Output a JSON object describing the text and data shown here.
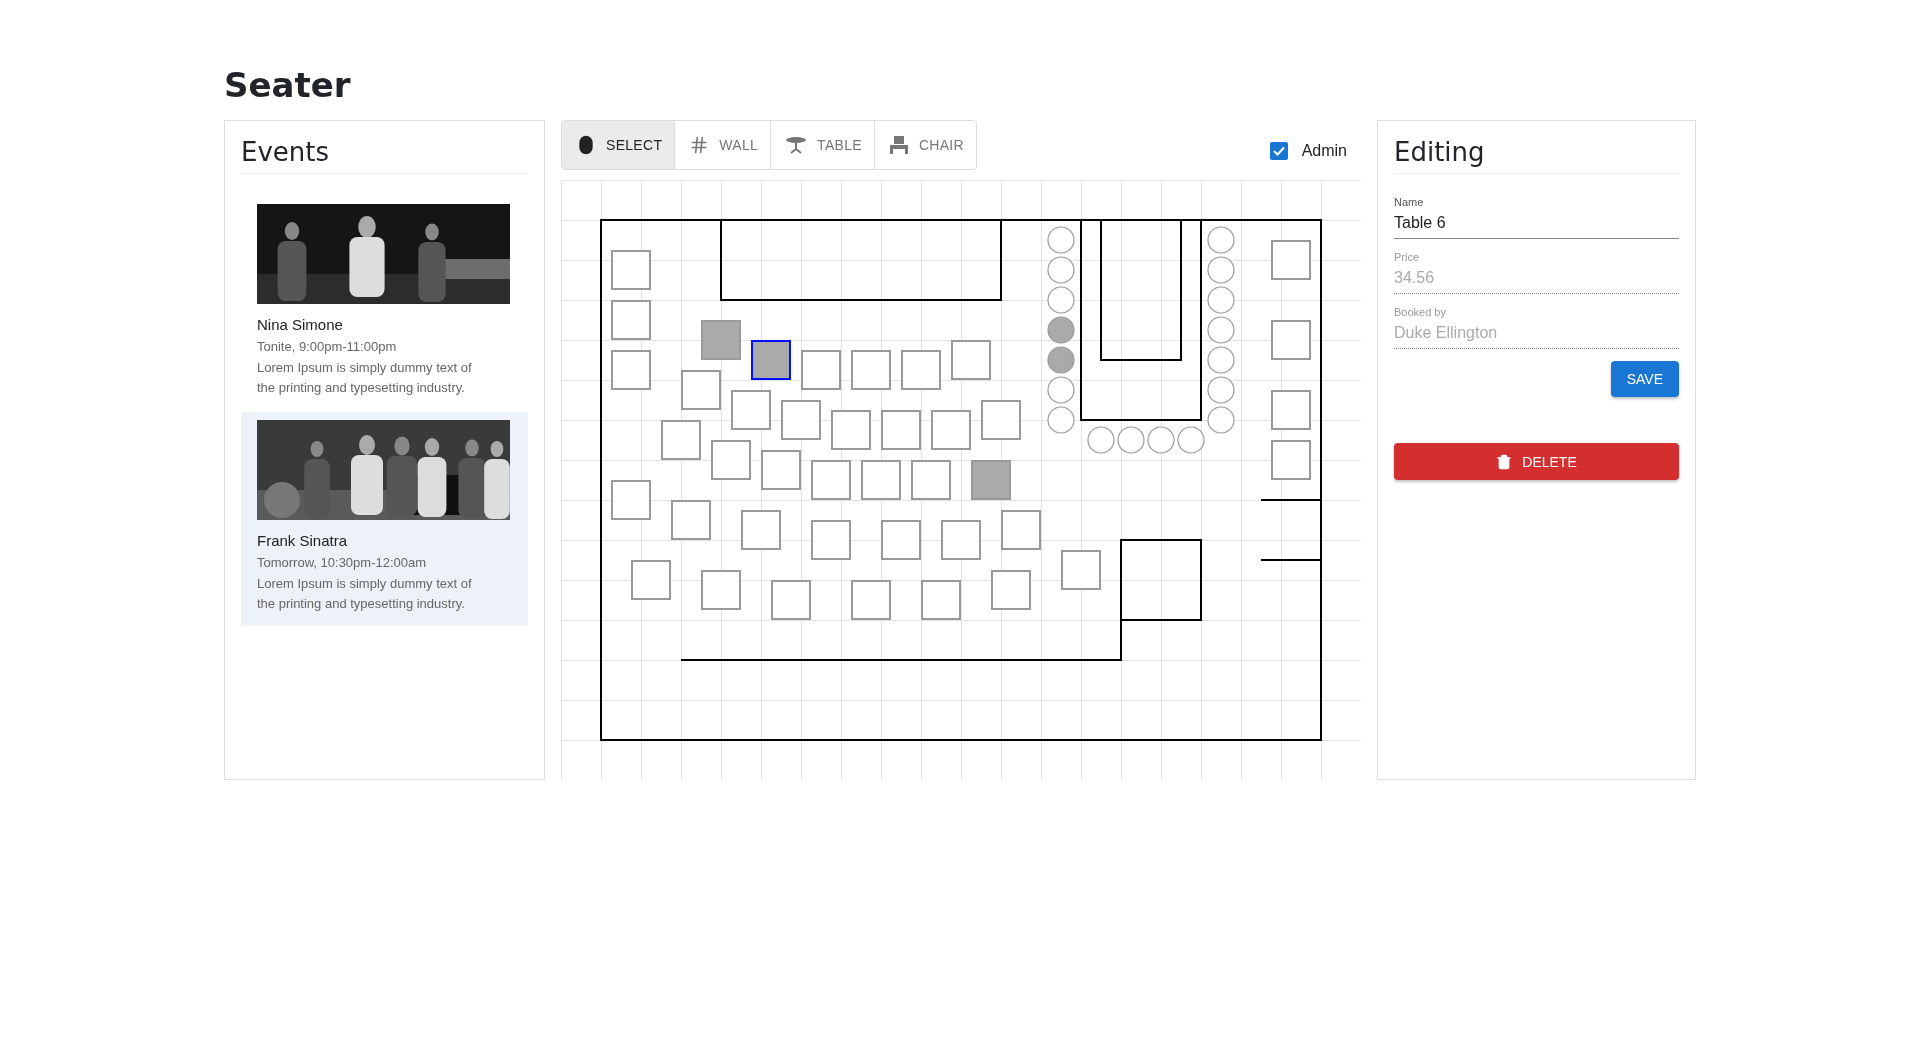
{
  "app_title": "Seater",
  "events": {
    "title": "Events",
    "items": [
      {
        "name": "Nina Simone",
        "time": "Tonite, 9:00pm-11:00pm",
        "description": "Lorem Ipsum is simply dummy text of the printing and typesetting industry.",
        "selected": false
      },
      {
        "name": "Frank Sinatra",
        "time": "Tomorrow, 10:30pm-12:00am",
        "description": "Lorem Ipsum is simply dummy text of the printing and typesetting industry.",
        "selected": true
      }
    ]
  },
  "toolbar": {
    "tools": [
      {
        "label": "SELECT",
        "kind": "select",
        "selected": true
      },
      {
        "label": "WALL",
        "kind": "wall",
        "selected": false
      },
      {
        "label": "TABLE",
        "kind": "table",
        "selected": false
      },
      {
        "label": "CHAIR",
        "kind": "chair",
        "selected": false
      }
    ],
    "admin": {
      "label": "Admin",
      "checked": true
    }
  },
  "floor": {
    "tables": [
      {
        "booked": false,
        "selected": false
      },
      {
        "booked": false,
        "selected": false
      },
      {
        "booked": false,
        "selected": false
      },
      {
        "booked": true,
        "selected": false
      },
      {
        "booked": true,
        "selected": true
      },
      {
        "booked": false,
        "selected": false
      },
      {
        "booked": false,
        "selected": false
      },
      {
        "booked": false,
        "selected": false
      },
      {
        "booked": false,
        "selected": false
      },
      {
        "booked": false,
        "selected": false
      },
      {
        "booked": false,
        "selected": false
      },
      {
        "booked": false,
        "selected": false
      },
      {
        "booked": false,
        "selected": false
      },
      {
        "booked": false,
        "selected": false
      },
      {
        "booked": false,
        "selected": false
      },
      {
        "booked": false,
        "selected": false
      },
      {
        "booked": false,
        "selected": false
      },
      {
        "booked": false,
        "selected": false
      },
      {
        "booked": false,
        "selected": false
      },
      {
        "booked": false,
        "selected": false
      },
      {
        "booked": false,
        "selected": false
      },
      {
        "booked": false,
        "selected": false
      },
      {
        "booked": true,
        "selected": false
      },
      {
        "booked": false,
        "selected": false
      },
      {
        "booked": false,
        "selected": false
      },
      {
        "booked": false,
        "selected": false
      },
      {
        "booked": false,
        "selected": false
      },
      {
        "booked": false,
        "selected": false
      },
      {
        "booked": false,
        "selected": false
      },
      {
        "booked": false,
        "selected": false
      },
      {
        "booked": false,
        "selected": false
      },
      {
        "booked": false,
        "selected": false
      },
      {
        "booked": false,
        "selected": false
      },
      {
        "booked": false,
        "selected": false
      },
      {
        "booked": false,
        "selected": false
      },
      {
        "booked": false,
        "selected": false
      },
      {
        "booked": false,
        "selected": false
      },
      {
        "booked": false,
        "selected": false
      },
      {
        "booked": false,
        "selected": false
      },
      {
        "booked": false,
        "selected": false
      },
      {
        "booked": false,
        "selected": false
      }
    ],
    "chairs": [
      {
        "booked": false
      },
      {
        "booked": false
      },
      {
        "booked": false
      },
      {
        "booked": true
      },
      {
        "booked": true
      },
      {
        "booked": false
      },
      {
        "booked": false
      },
      {
        "booked": false
      },
      {
        "booked": false
      },
      {
        "booked": false
      },
      {
        "booked": false
      },
      {
        "booked": false
      },
      {
        "booked": false
      },
      {
        "booked": false
      },
      {
        "booked": false
      },
      {
        "booked": false
      },
      {
        "booked": false
      },
      {
        "booked": false
      }
    ]
  },
  "editing": {
    "title": "Editing",
    "fields": [
      {
        "label": "Name",
        "value": "Table 6",
        "disabled": false
      },
      {
        "label": "Price",
        "value": "34.56",
        "disabled": true
      },
      {
        "label": "Booked by",
        "value": "Duke Ellington",
        "disabled": true
      }
    ],
    "save": "SAVE",
    "delete": "DELETE"
  }
}
